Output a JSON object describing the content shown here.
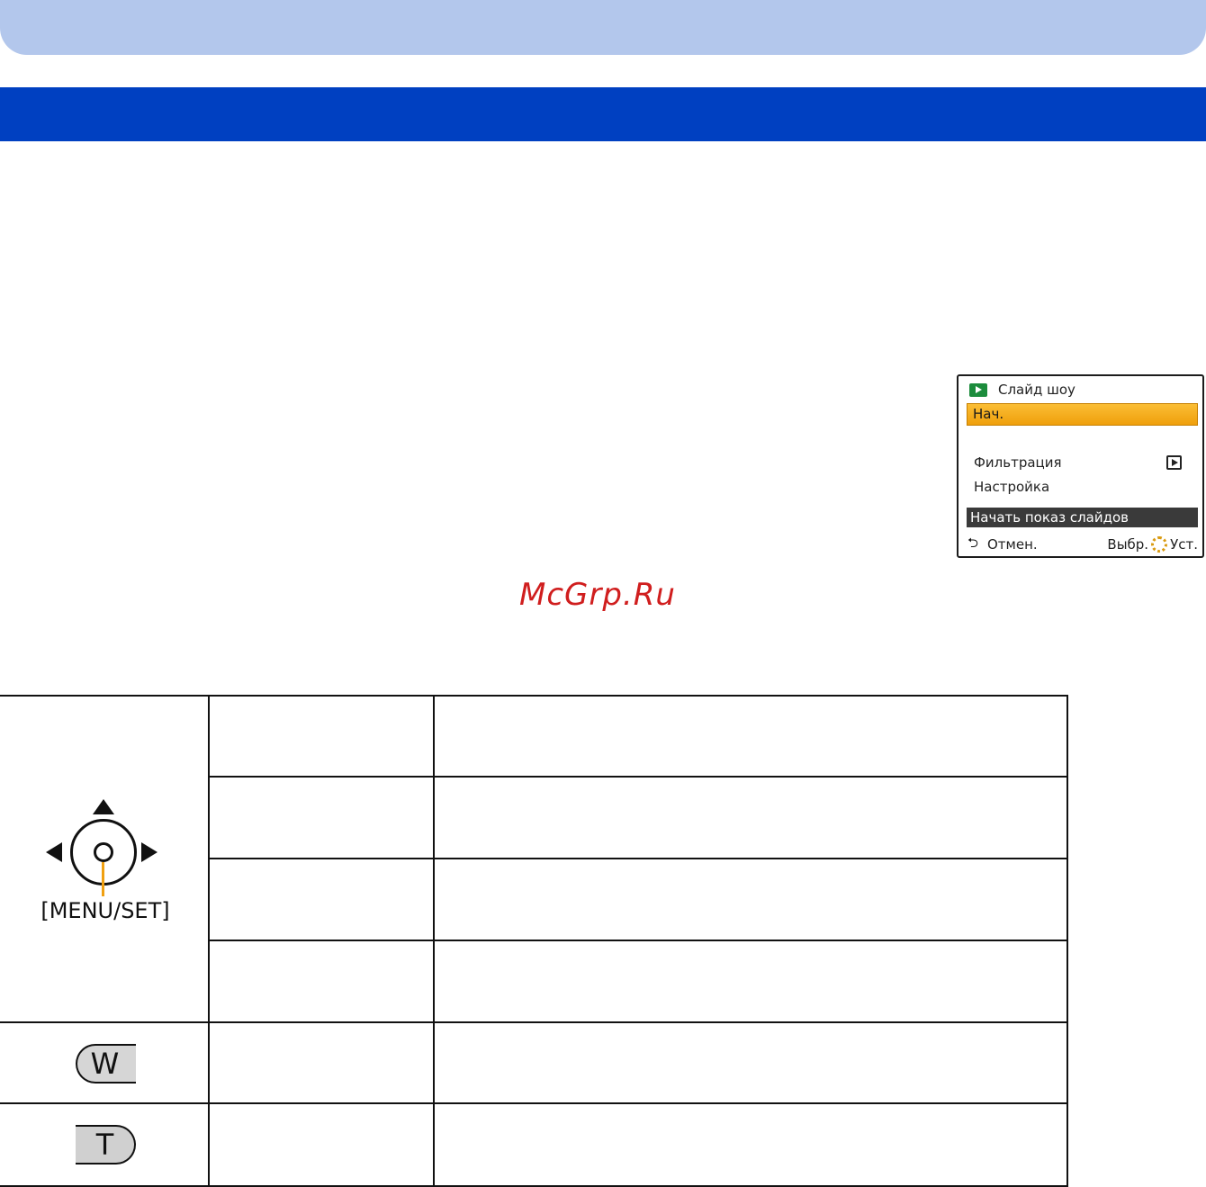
{
  "camera_screen": {
    "title": "Слайд шоу",
    "selected_item": "Нач.",
    "items": [
      "Фильтрация",
      "Настройка"
    ],
    "status_text": "Начать показ слайдов",
    "footer": {
      "cancel": "Отмен.",
      "select": "Выбр.",
      "set": "Уст."
    }
  },
  "watermark": "McGrp.Ru",
  "controls": {
    "menu_set_label": "[MENU/SET]",
    "zoom_w_label": "W",
    "zoom_t_label": "T"
  },
  "colors": {
    "header_light": "#b3c7ec",
    "section_bar": "#0040c1",
    "highlight": "#f0a011",
    "watermark": "#d01e1e"
  }
}
